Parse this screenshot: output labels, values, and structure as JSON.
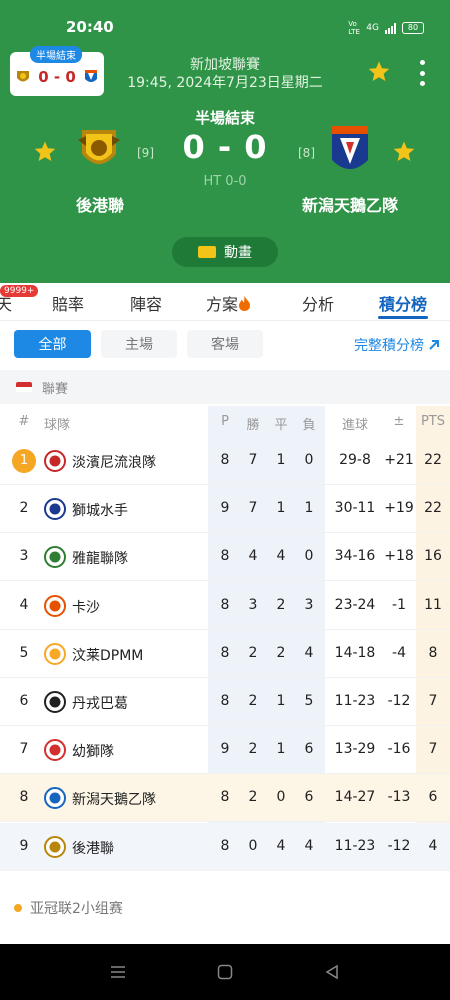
{
  "status_bar": {
    "time": "20:40",
    "net_label": "Vo LTE",
    "net_type": "4G",
    "battery": "80"
  },
  "mini_card": {
    "badge": "半場結束",
    "score": "0 - 0"
  },
  "match": {
    "league": "新加坡聯賽",
    "datetime": "19:45, 2024年7月23日星期二",
    "status": "半場結束",
    "score": "0 - 0",
    "halftime": "HT 0-0",
    "home": {
      "name": "後港聯",
      "rank": "[9]"
    },
    "away": {
      "name": "新潟天鵝乙隊",
      "rank": "[8]"
    },
    "animation_label": "動畫"
  },
  "tabs": [
    {
      "label": "天"
    },
    {
      "label": "賠率"
    },
    {
      "label": "陣容"
    },
    {
      "label": "方案"
    },
    {
      "label": "分析"
    },
    {
      "label": "積分榜",
      "active": true
    }
  ],
  "tab_badge": "9999+",
  "filters": {
    "all": "全部",
    "home": "主場",
    "away": "客場",
    "full_table": "完整積分榜"
  },
  "section_title": "聯賽",
  "table": {
    "headers": {
      "rank": "#",
      "team": "球隊",
      "p": "P",
      "w": "勝",
      "d": "平",
      "l": "負",
      "goals": "進球",
      "diff": "±",
      "pts": "PTS"
    },
    "rows": [
      {
        "rank": "1",
        "team": "淡濱尼流浪隊",
        "p": "8",
        "w": "7",
        "d": "1",
        "l": "0",
        "goals": "29-8",
        "diff": "+21",
        "pts": "22",
        "color": "#c62828"
      },
      {
        "rank": "2",
        "team": "獅城水手",
        "p": "9",
        "w": "7",
        "d": "1",
        "l": "1",
        "goals": "30-11",
        "diff": "+19",
        "pts": "22",
        "color": "#1a3a8f"
      },
      {
        "rank": "3",
        "team": "雅龍聯隊",
        "p": "8",
        "w": "4",
        "d": "4",
        "l": "0",
        "goals": "34-16",
        "diff": "+18",
        "pts": "16",
        "color": "#2e7d32"
      },
      {
        "rank": "4",
        "team": "卡沙",
        "p": "8",
        "w": "3",
        "d": "2",
        "l": "3",
        "goals": "23-24",
        "diff": "-1",
        "pts": "11",
        "color": "#e65100"
      },
      {
        "rank": "5",
        "team": "汶莱DPMM",
        "p": "8",
        "w": "2",
        "d": "2",
        "l": "4",
        "goals": "14-18",
        "diff": "-4",
        "pts": "8",
        "color": "#f9a825"
      },
      {
        "rank": "6",
        "team": "丹戎巴葛",
        "p": "8",
        "w": "2",
        "d": "1",
        "l": "5",
        "goals": "11-23",
        "diff": "-12",
        "pts": "7",
        "color": "#212121"
      },
      {
        "rank": "7",
        "team": "幼獅隊",
        "p": "9",
        "w": "2",
        "d": "1",
        "l": "6",
        "goals": "13-29",
        "diff": "-16",
        "pts": "7",
        "color": "#d32f2f"
      },
      {
        "rank": "8",
        "team": "新潟天鵝乙隊",
        "p": "8",
        "w": "2",
        "d": "0",
        "l": "6",
        "goals": "14-27",
        "diff": "-13",
        "pts": "6",
        "color": "#1565c0"
      },
      {
        "rank": "9",
        "team": "後港聯",
        "p": "8",
        "w": "0",
        "d": "4",
        "l": "4",
        "goals": "11-23",
        "diff": "-12",
        "pts": "4",
        "color": "#b8860b"
      }
    ]
  },
  "bottom_section": "亚冠联2小组赛",
  "colors": {
    "header_green": "#2f9447",
    "accent_blue": "#1e88e5",
    "star": "#f2c318",
    "rank_gold": "#f5a623"
  }
}
